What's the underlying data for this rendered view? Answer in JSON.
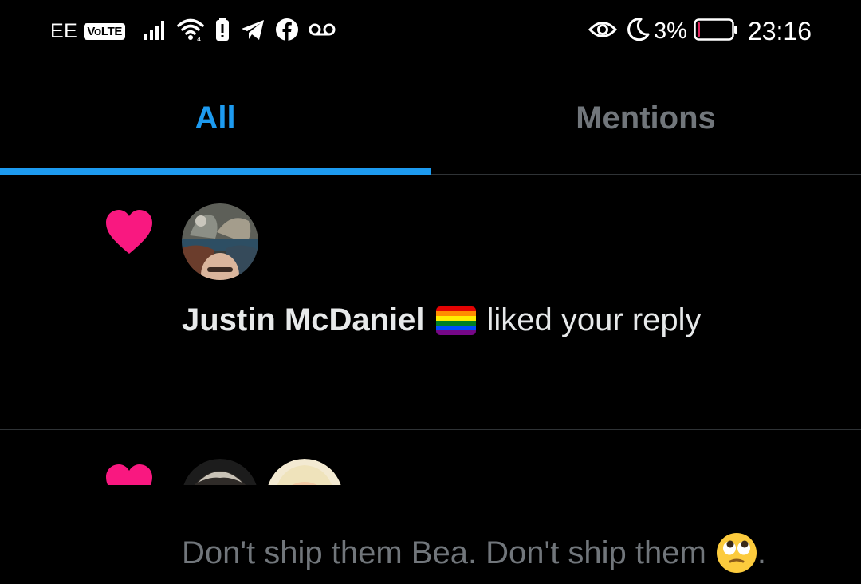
{
  "status_bar": {
    "carrier": "EE",
    "volte": "VoLTE",
    "battery_percent": "3%",
    "time": "23:16",
    "battery_level": 0.03,
    "left_icons": [
      "signal-icon",
      "wifi-icon",
      "battery-alert-icon",
      "telegram-icon",
      "facebook-icon",
      "voicemail-icon"
    ],
    "right_icons": [
      "eye-comfort-icon",
      "moon-icon",
      "battery-icon"
    ]
  },
  "tabs": [
    {
      "label": "All",
      "active": true
    },
    {
      "label": "Mentions",
      "active": false
    }
  ],
  "notifications": [
    {
      "type": "like",
      "icon": "heart-icon",
      "user_name": "Justin McDaniel",
      "user_badge_icon": "rainbow-flag-icon",
      "action": "liked your reply",
      "tweet_text": "Don't ship them Bea. Don't ship them",
      "tweet_emoji_icon": "face-with-rolling-eyes-icon",
      "tweet_trailing": "."
    },
    {
      "type": "like",
      "icon": "heart-icon"
    }
  ],
  "colors": {
    "background": "#000000",
    "accent": "#1d9bf0",
    "heart": "#f91880",
    "muted_text": "#71767b",
    "primary_text": "#e7e9ea",
    "divider": "#2f3336",
    "battery_low": "#e0245e"
  }
}
